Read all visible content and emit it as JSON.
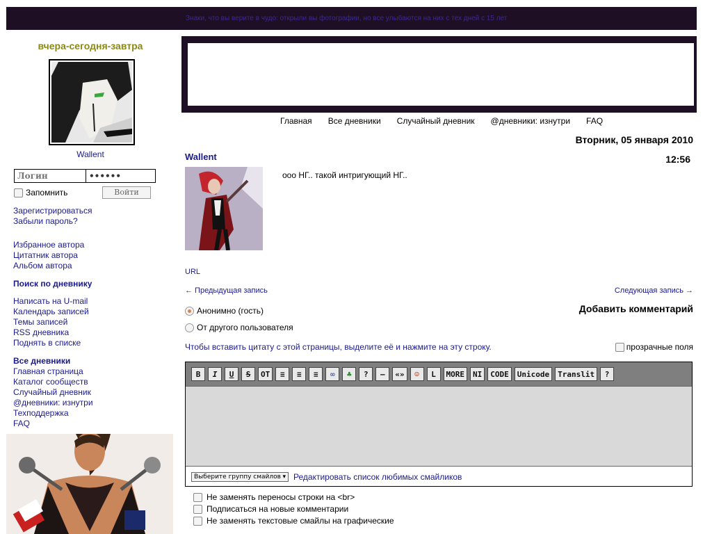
{
  "topbar": {
    "ticker": "Знаки, что вы верите в чудо: открыли вы фотографии, но все улыбаются на них с тех дней с 15 лет"
  },
  "sidebar": {
    "site_title": "вчера-сегодня-завтра",
    "username": "Wallent",
    "login_placeholder": "Логин",
    "password_value": "••••••",
    "remember_label": "Запомнить",
    "login_button": "Войти",
    "auth_links": [
      "Зарегистрироваться",
      "Забыли пароль?"
    ],
    "author_links": [
      "Избранное автора",
      "Цитатник автора",
      "Альбом автора"
    ],
    "search_heading": "Поиск по дневнику",
    "diary_links": [
      "Написать на U-mail",
      "Календарь записей",
      "Темы записей",
      "RSS дневника",
      "Поднять в списке"
    ],
    "all_heading": "Все дневники",
    "all_links": [
      "Главная страница",
      "Каталог сообществ",
      "Случайный дневник",
      "@дневники: изнутри",
      "Техподдержка",
      "FAQ"
    ]
  },
  "nav": [
    "Главная",
    "Все дневники",
    "Случайный дневник",
    "@дневники: изнутри",
    "FAQ"
  ],
  "post": {
    "date": "Вторник, 05 января 2010",
    "time": "12:56",
    "author": "Wallent",
    "text": "ооо НГ.. такой интригующий НГ..",
    "url_label": "URL",
    "prev_label": "← Предыдущая запись",
    "next_label": "Следующая запись →"
  },
  "comment": {
    "heading": "Добавить комментарий",
    "radio_anon": "Анонимно (гость)",
    "radio_other": "От другого пользователя",
    "quote_hint": "Чтобы вставить цитату с этой страницы, выделите её и нажмите на эту строку.",
    "transparent_label": "прозрачные поля",
    "toolbar": [
      "B",
      "I",
      "U",
      "S",
      "OT",
      "≡",
      "≡",
      "≡",
      "∞",
      "♣",
      "?",
      "—",
      "«»",
      "☺",
      "L",
      "MORE",
      "NI",
      "CODE",
      "Unicode",
      "Translit",
      "?"
    ],
    "smile_select": "Выберите группу смайлов",
    "edit_smiles": "Редактировать список любимых смайликов",
    "options": [
      "Не заменять переносы строки на <br>",
      "Подписаться на новые комментарии",
      "Не заменять текстовые смайлы на графические"
    ]
  },
  "colors": {
    "frame": "#1f0f24",
    "link": "#1a1a8c",
    "title": "#8a8a14"
  }
}
